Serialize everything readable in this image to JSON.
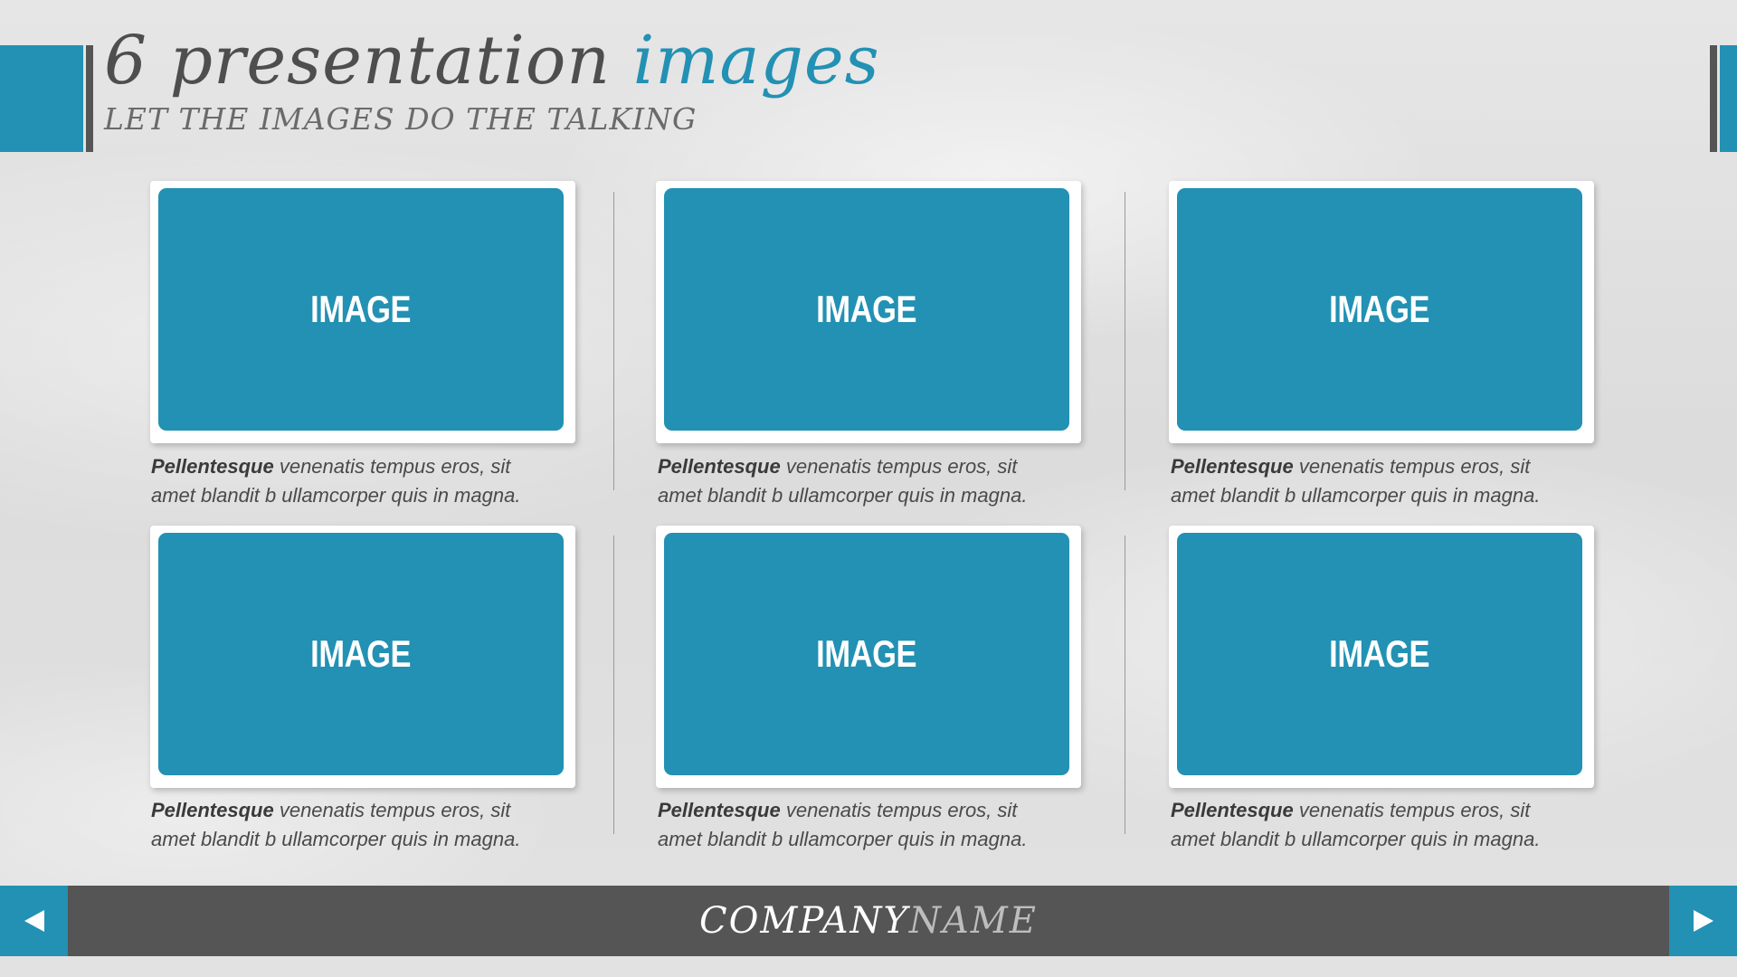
{
  "slide": {
    "title_main": "6 presentation ",
    "title_accent": "images",
    "subtitle": "LET THE IMAGES DO THE TALKING"
  },
  "cards": [
    {
      "image_label": "IMAGE",
      "caption_bold": "Pellentesque",
      "caption_line1_rest": " venenatis tempus eros, sit",
      "caption_line2": "amet blandit b ullamcorper quis in magna."
    },
    {
      "image_label": "IMAGE",
      "caption_bold": "Pellentesque",
      "caption_line1_rest": " venenatis tempus eros, sit",
      "caption_line2": "amet blandit b ullamcorper quis in magna."
    },
    {
      "image_label": "IMAGE",
      "caption_bold": "Pellentesque",
      "caption_line1_rest": " venenatis tempus eros, sit",
      "caption_line2": "amet blandit b ullamcorper quis in magna."
    },
    {
      "image_label": "IMAGE",
      "caption_bold": "Pellentesque",
      "caption_line1_rest": " venenatis tempus eros, sit",
      "caption_line2": "amet blandit b ullamcorper quis in magna."
    },
    {
      "image_label": "IMAGE",
      "caption_bold": "Pellentesque",
      "caption_line1_rest": " venenatis tempus eros, sit",
      "caption_line2": "amet blandit b ullamcorper quis in magna."
    },
    {
      "image_label": "IMAGE",
      "caption_bold": "Pellentesque",
      "caption_line1_rest": " venenatis tempus eros, sit",
      "caption_line2": "amet blandit b ullamcorper quis in magna."
    }
  ],
  "footer": {
    "company_part1": "COMPANY",
    "company_part2": "NAME",
    "prev_icon": "triangle-left-icon",
    "next_icon": "triangle-right-icon"
  },
  "colors": {
    "accent": "#2291b3",
    "dark_gray": "#555555",
    "text": "#4a4a4a"
  }
}
